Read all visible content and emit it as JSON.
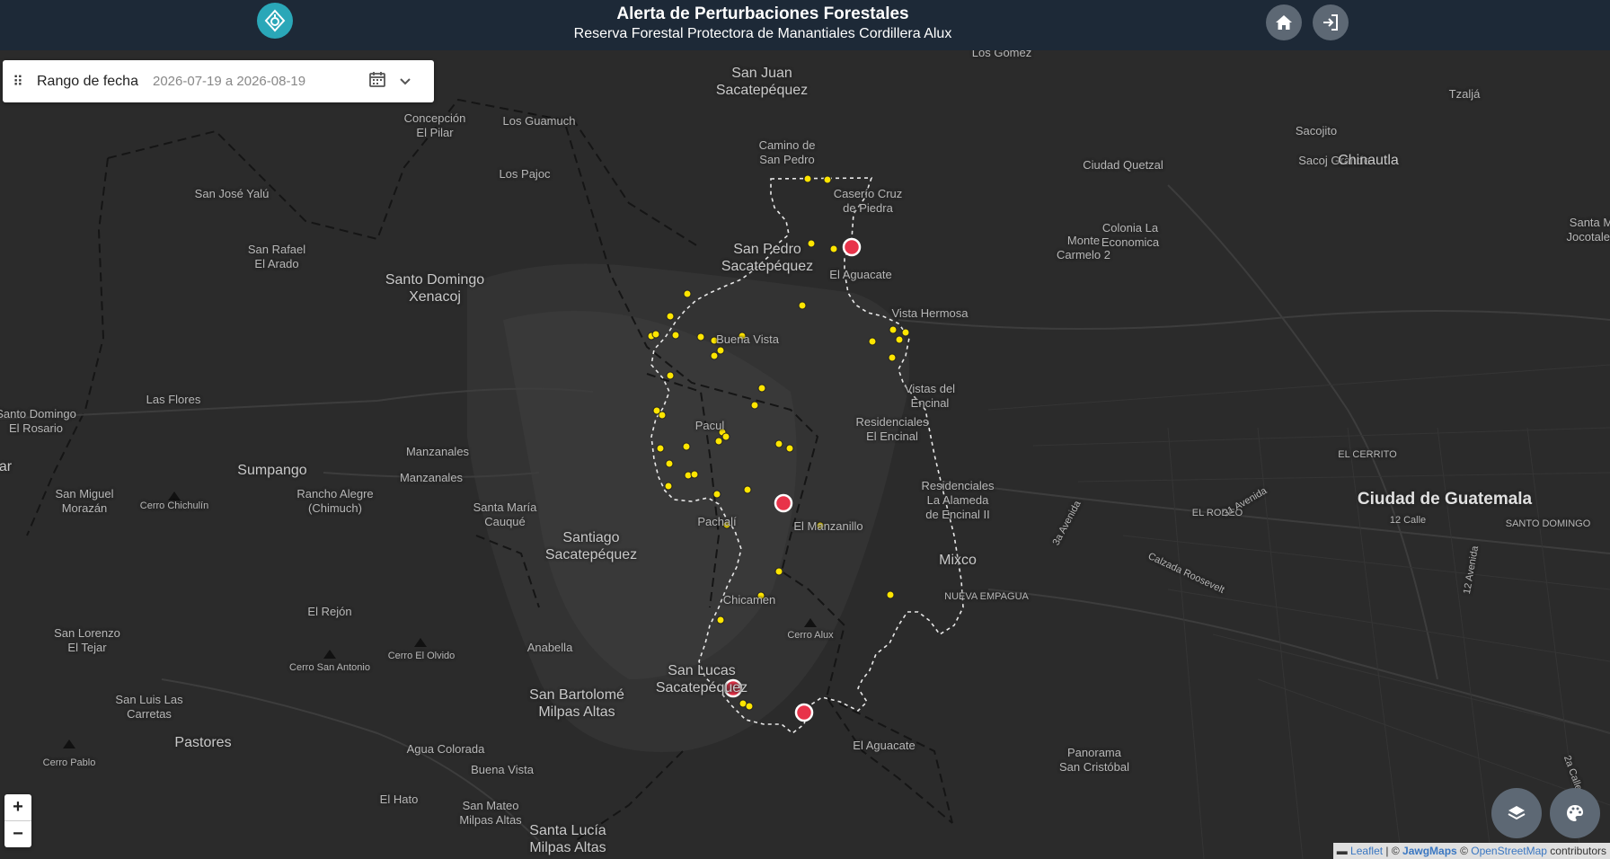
{
  "header": {
    "title": "Alerta de Perturbaciones Forestales",
    "subtitle": "Reserva Forestal Protectora de Manantiales Cordillera Alux",
    "logo_icon": "forest-alert-logo-icon",
    "home_icon": "home-icon",
    "login_icon": "login-icon"
  },
  "date_filter": {
    "label": "Rango de fecha",
    "value": "2026-07-19 a 2026-08-19",
    "calendar_icon": "calendar-icon",
    "toggle_icon": "chevron-down-icon"
  },
  "zoom": {
    "in": "+",
    "out": "−"
  },
  "map_controls": {
    "layers_icon": "layers-icon",
    "style_icon": "palette-icon"
  },
  "attribution": {
    "leaflet": "Leaflet",
    "sep": " | © ",
    "jawg": "JawgMaps",
    "osm_prefix": " © ",
    "osm": "OpenStreetMap",
    "suffix": " contributors"
  },
  "colors": {
    "header_bg": "#1d2937",
    "logo_bg": "#2aa7b8",
    "alert_yellow": "#ffe500",
    "alert_red": "#e8334a",
    "map_bg": "#2b2b2b"
  },
  "places": [
    {
      "name": "Los Gomez",
      "size": "n"
    },
    {
      "name": "Tzaljá",
      "size": "n"
    },
    {
      "name": "San Juan\nSacatepéquez",
      "size": "lg"
    },
    {
      "name": "Concepción\nEl Pilar",
      "size": "n"
    },
    {
      "name": "Los Guamuch",
      "size": "n"
    },
    {
      "name": "Sacojito",
      "size": "n"
    },
    {
      "name": "Camino de\nSan Pedro",
      "size": "n"
    },
    {
      "name": "Ciudad Quetzal",
      "size": "n"
    },
    {
      "name": "Sacoj Grande",
      "size": "n"
    },
    {
      "name": "Chinautla",
      "size": "lg"
    },
    {
      "name": "Los Pajoc",
      "size": "n"
    },
    {
      "name": "Caserío Cruz\nde Piedra",
      "size": "n"
    },
    {
      "name": "San José Yalú",
      "size": "n"
    },
    {
      "name": "San Pedro\nSacatepéquez",
      "size": "lg"
    },
    {
      "name": "El Aguacate",
      "size": "n"
    },
    {
      "name": "Monte\nCarmelo 2",
      "size": "n"
    },
    {
      "name": "Colonia La\nEconomica",
      "size": "n"
    },
    {
      "name": "Santa M\nJocotales",
      "size": "n"
    },
    {
      "name": "San Rafael\nEl Arado",
      "size": "n"
    },
    {
      "name": "Santo Domingo\nXenacoj",
      "size": "lg"
    },
    {
      "name": "Vista Hermosa",
      "size": "n"
    },
    {
      "name": "Buena Vista",
      "size": "n"
    },
    {
      "name": "Las Flores",
      "size": "n"
    },
    {
      "name": "Vistas del\nEncinal",
      "size": "n"
    },
    {
      "name": "Santo Domingo\nEl Rosario",
      "size": "n"
    },
    {
      "name": "Pacul",
      "size": "n"
    },
    {
      "name": "Residenciales\nEl Encinal",
      "size": "n"
    },
    {
      "name": "Manzanales",
      "size": "n"
    },
    {
      "name": "EL CERRITO",
      "size": "sm"
    },
    {
      "name": "ar",
      "size": "lg"
    },
    {
      "name": "Sumpango",
      "size": "lg"
    },
    {
      "name": "Manzanales",
      "size": "n"
    },
    {
      "name": "Residenciales\nLa Alameda\nde Encinal II",
      "size": "n"
    },
    {
      "name": "San Miguel\nMorazán",
      "size": "n"
    },
    {
      "name": "Rancho Alegre\n(Chimuch)",
      "size": "n"
    },
    {
      "name": "Ciudad de Guatemala",
      "size": "xl"
    },
    {
      "name": "Cerro Chichulín",
      "size": "sm"
    },
    {
      "name": "Santa María\nCauqué",
      "size": "n"
    },
    {
      "name": "Pachalí",
      "size": "n"
    },
    {
      "name": "EL RODEO",
      "size": "sm"
    },
    {
      "name": "El Manzanillo",
      "size": "n"
    },
    {
      "name": "Santiago\nSacatepéquez",
      "size": "lg"
    },
    {
      "name": "12 Calle",
      "size": "sm"
    },
    {
      "name": "SANTO DOMINGO",
      "size": "sm"
    },
    {
      "name": "Mixco",
      "size": "lg"
    },
    {
      "name": "NUEVA EMPAGUA",
      "size": "sm"
    },
    {
      "name": "Chicamen",
      "size": "n"
    },
    {
      "name": "El Rejón",
      "size": "n"
    },
    {
      "name": "Cerro Alux",
      "size": "sm"
    },
    {
      "name": "San Lorenzo\nEl Tejar",
      "size": "n"
    },
    {
      "name": "Cerro El Olvido",
      "size": "sm"
    },
    {
      "name": "Cerro San Antonio",
      "size": "sm"
    },
    {
      "name": "Anabella",
      "size": "n"
    },
    {
      "name": "San Lucas\nSacatepéquez",
      "size": "lg"
    },
    {
      "name": "San Bartolomé\nMilpas Altas",
      "size": "lg"
    },
    {
      "name": "San Luis Las\nCarretas",
      "size": "n"
    },
    {
      "name": "Pastores",
      "size": "lg"
    },
    {
      "name": "Agua Colorada",
      "size": "n"
    },
    {
      "name": "El Aguacate",
      "size": "n"
    },
    {
      "name": "Panorama\nSan Cristóbal",
      "size": "n"
    },
    {
      "name": "Cerro Pablo",
      "size": "sm"
    },
    {
      "name": "Buena Vista",
      "size": "n"
    },
    {
      "name": "El Hato",
      "size": "n"
    },
    {
      "name": "San Mateo\nMilpas Altas",
      "size": "n"
    },
    {
      "name": "Santa Lucía\nMilpas Altas",
      "size": "lg"
    },
    {
      "name": "3a Avenida",
      "size": "sm"
    },
    {
      "name": "31 Avenida",
      "size": "sm"
    },
    {
      "name": "Calzada Roosevelt",
      "size": "sm"
    },
    {
      "name": "12 Avenida",
      "size": "sm"
    },
    {
      "name": "2a Calle",
      "size": "sm"
    }
  ]
}
